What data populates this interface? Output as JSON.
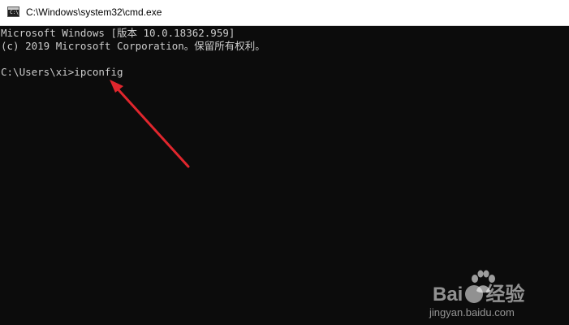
{
  "window": {
    "title": "C:\\Windows\\system32\\cmd.exe",
    "icon": "cmd-console-icon",
    "icon_text": "C:\\"
  },
  "console": {
    "lines": [
      "Microsoft Windows [版本 10.0.18362.959]",
      "(c) 2019 Microsoft Corporation。保留所有权利。",
      "C:\\Users\\xi>ipconfig"
    ]
  },
  "annotation": {
    "type": "arrow",
    "color": "#e0262d"
  },
  "watermark": {
    "brand_left": "Bai",
    "brand_right": "经验",
    "site": "jingyan.baidu.com"
  },
  "colors": {
    "console_bg": "#0c0c0c",
    "console_text": "#cccccc",
    "titlebar_bg": "#ffffff"
  }
}
